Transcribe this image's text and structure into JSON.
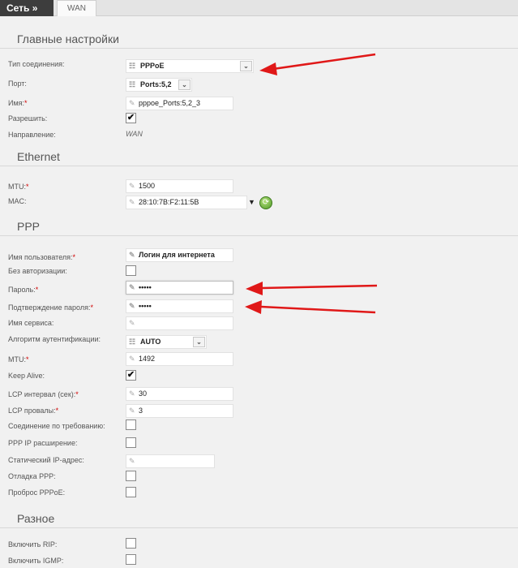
{
  "header": {
    "breadcrumb": "Сеть »",
    "tab": "WAN"
  },
  "sections": {
    "main": "Главные настройки",
    "ethernet": "Ethernet",
    "ppp": "PPP",
    "misc": "Разное"
  },
  "main": {
    "connection_type_label": "Тип соединения:",
    "connection_type_value": "PPPoE",
    "port_label": "Порт:",
    "port_value": "Ports:5,2",
    "name_label": "Имя:",
    "name_value": "pppoe_Ports:5,2_3",
    "enable_label": "Разрешить:",
    "direction_label": "Направление:",
    "direction_value": "WAN"
  },
  "ethernet": {
    "mtu_label": "MTU:",
    "mtu_value": "1500",
    "mac_label": "MAC:",
    "mac_value": "28:10:7B:F2:11:5B"
  },
  "ppp": {
    "username_label": "Имя пользователя:",
    "username_value": "Логин для интернета",
    "no_auth_label": "Без авторизации:",
    "password_label": "Пароль:",
    "password_value": "•••••",
    "confirm_label": "Подтверждение пароля:",
    "confirm_value": "•••••",
    "service_label": "Имя сервиса:",
    "auth_algo_label": "Алгоритм аутентификации:",
    "auth_algo_value": "AUTO",
    "mtu_label": "MTU:",
    "mtu_value": "1492",
    "keepalive_label": "Keep Alive:",
    "lcp_interval_label": "LCP интервал (сек):",
    "lcp_interval_value": "30",
    "lcp_fails_label": "LCP провалы:",
    "lcp_fails_value": "3",
    "on_demand_label": "Соединение по требованию:",
    "ip_ext_label": "PPP IP расширение:",
    "static_ip_label": "Статический IP-адрес:",
    "debug_label": "Отладка PPP:",
    "passthrough_label": "Проброс PPPoE:"
  },
  "misc": {
    "rip_label": "Включить RIP:",
    "igmp_label": "Включить IGMP:"
  },
  "icons": {
    "check": "✔",
    "pencil": "✎",
    "list": "☷",
    "dropdown": "⌄",
    "mac_dropdown": "▼",
    "refresh": "⟳"
  },
  "colors": {
    "required": "#d00000",
    "annotation_arrow": "#e01818"
  },
  "checkbox_states": {
    "enable": true,
    "no_auth": false,
    "keepalive": true,
    "on_demand": false,
    "ip_ext": false,
    "debug": false,
    "passthrough": false,
    "rip": false,
    "igmp": false
  }
}
